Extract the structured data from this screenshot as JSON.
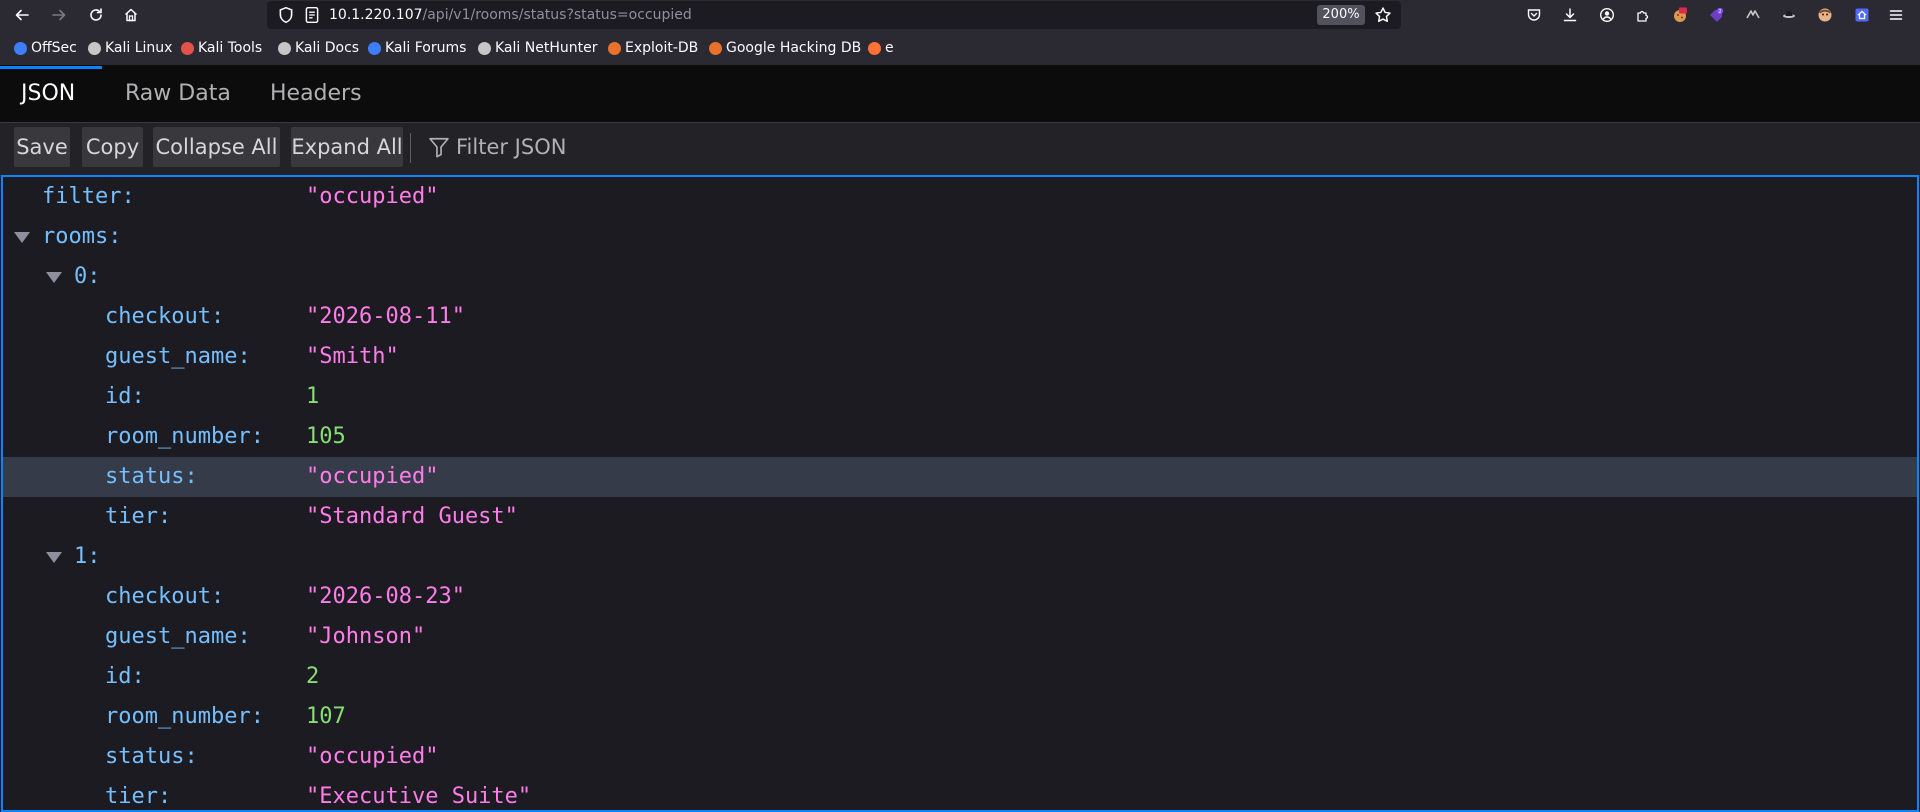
{
  "browser": {
    "url_host": "10.1.220.107",
    "url_path": "/api/v1/rooms/status?status=occupied",
    "zoom": "200%"
  },
  "bookmarks": [
    {
      "label": "OffSec",
      "icon": "offsec-icon",
      "color": "#3d7dff"
    },
    {
      "label": "Kali Linux",
      "icon": "kali-dragon-icon",
      "color": "#c6c6c6"
    },
    {
      "label": "Kali Tools",
      "icon": "kali-tools-icon",
      "color": "#e2534c"
    },
    {
      "label": "Kali Docs",
      "icon": "kali-dragon-icon",
      "color": "#c6c6c6"
    },
    {
      "label": "Kali Forums",
      "icon": "kali-forums-icon",
      "color": "#3d7dff"
    },
    {
      "label": "Kali NetHunter",
      "icon": "kali-dragon-icon",
      "color": "#c6c6c6"
    },
    {
      "label": "Exploit-DB",
      "icon": "exploit-db-icon",
      "color": "#e8712c"
    },
    {
      "label": "Google Hacking DB",
      "icon": "ghdb-icon",
      "color": "#e8712c"
    },
    {
      "label": "e",
      "icon": "firefox-icon",
      "color": "#ff7139"
    }
  ],
  "viewer": {
    "tabs": [
      "JSON",
      "Raw Data",
      "Headers"
    ],
    "toolbar": {
      "save": "Save",
      "copy": "Copy",
      "collapse_all": "Collapse All",
      "expand_all": "Expand All",
      "filter_placeholder": "Filter JSON"
    }
  },
  "json": {
    "filter_key": "filter:",
    "filter_value": "\"occupied\"",
    "rooms_key": "rooms:",
    "rooms": [
      {
        "index_label": "0:",
        "fields": [
          {
            "key": "checkout:",
            "value": "\"2026-08-11\"",
            "type": "string"
          },
          {
            "key": "guest_name:",
            "value": "\"Smith\"",
            "type": "string"
          },
          {
            "key": "id:",
            "value": "1",
            "type": "number"
          },
          {
            "key": "room_number:",
            "value": "105",
            "type": "number"
          },
          {
            "key": "status:",
            "value": "\"occupied\"",
            "type": "string",
            "selected": true
          },
          {
            "key": "tier:",
            "value": "\"Standard Guest\"",
            "type": "string"
          }
        ]
      },
      {
        "index_label": "1:",
        "fields": [
          {
            "key": "checkout:",
            "value": "\"2026-08-23\"",
            "type": "string"
          },
          {
            "key": "guest_name:",
            "value": "\"Johnson\"",
            "type": "string"
          },
          {
            "key": "id:",
            "value": "2",
            "type": "number"
          },
          {
            "key": "room_number:",
            "value": "107",
            "type": "number"
          },
          {
            "key": "status:",
            "value": "\"occupied\"",
            "type": "string"
          },
          {
            "key": "tier:",
            "value": "\"Executive Suite\"",
            "type": "string"
          }
        ]
      }
    ]
  }
}
